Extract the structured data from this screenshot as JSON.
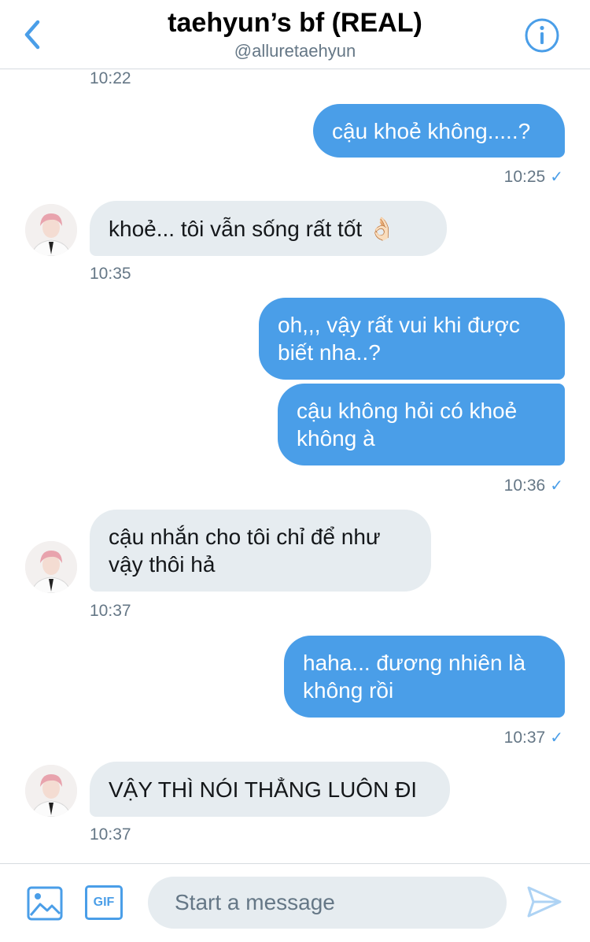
{
  "header": {
    "title": "taehyun’s bf (REAL)",
    "handle": "@alluretaehyun",
    "back_icon": "chevron-left-icon",
    "info_icon": "info-icon"
  },
  "colors": {
    "accent": "#4a9ee8",
    "incoming_bubble": "#e6ecf0",
    "muted_text": "#657786"
  },
  "messages": [
    {
      "id": "ts0",
      "type": "timestamp",
      "text": "10:22"
    },
    {
      "id": "m1",
      "direction": "outgoing",
      "text": "cậu khoẻ không.....?"
    },
    {
      "id": "ts1",
      "type": "timestamp",
      "text": "10:25",
      "read_check": "✓"
    },
    {
      "id": "m2",
      "direction": "incoming",
      "text": "khoẻ... tôi vẫn sống rất tốt 👌🏻"
    },
    {
      "id": "ts2",
      "type": "timestamp",
      "text": "10:35"
    },
    {
      "id": "m3",
      "direction": "outgoing",
      "text": "oh,,, vậy rất vui khi được biết nha..?"
    },
    {
      "id": "m4",
      "direction": "outgoing",
      "text": "cậu không hỏi có khoẻ không à"
    },
    {
      "id": "ts3",
      "type": "timestamp",
      "text": "10:36",
      "read_check": "✓"
    },
    {
      "id": "m5",
      "direction": "incoming",
      "text": "cậu nhắn cho tôi chỉ để như vậy thôi hả"
    },
    {
      "id": "ts4",
      "type": "timestamp",
      "text": "10:37"
    },
    {
      "id": "m6",
      "direction": "outgoing",
      "text": "haha... đương nhiên là không rồi"
    },
    {
      "id": "ts5",
      "type": "timestamp",
      "text": "10:37",
      "read_check": "✓"
    },
    {
      "id": "m7",
      "direction": "incoming",
      "text": "VẬY THÌ NÓI THẲNG LUÔN ĐI"
    },
    {
      "id": "ts6",
      "type": "timestamp",
      "text": "10:37"
    }
  ],
  "composer": {
    "image_icon": "image-icon",
    "gif_label": "GIF",
    "placeholder": "Start a message",
    "send_icon": "send-icon"
  }
}
